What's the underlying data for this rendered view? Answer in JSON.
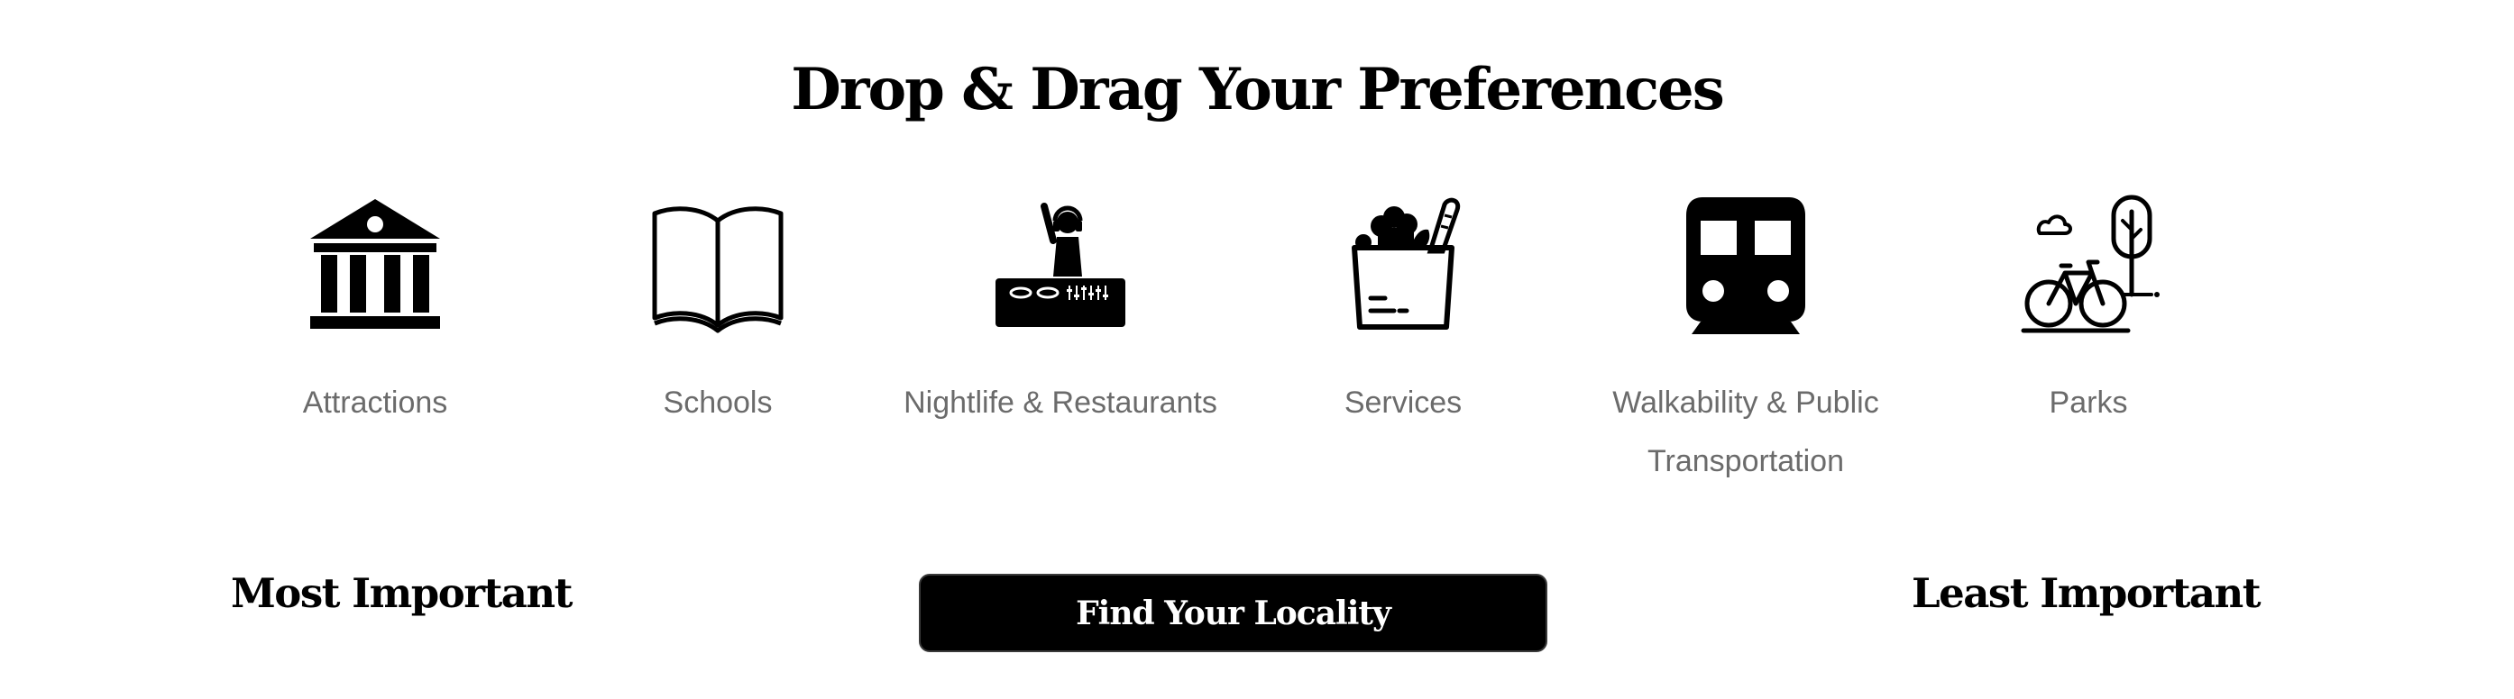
{
  "header": {
    "title": "Drop & Drag Your Preferences"
  },
  "preferences": [
    {
      "label": "Attractions",
      "icon": "museum-icon"
    },
    {
      "label": "Schools",
      "icon": "open-book-icon"
    },
    {
      "label": "Nightlife & Restaurants",
      "icon": "dj-booth-icon"
    },
    {
      "label": "Services",
      "icon": "grocery-bag-icon"
    },
    {
      "label": "Walkability & Public Transportation",
      "icon": "train-icon"
    },
    {
      "label": "Parks",
      "icon": "bicycle-tree-icon"
    }
  ],
  "ranking": {
    "most_label": "Most Important",
    "least_label": "Least Important"
  },
  "cta": {
    "label": "Find Your Locality"
  },
  "colors": {
    "text_primary": "#000000",
    "text_secondary": "#6b6b6b",
    "button_bg": "#000000",
    "button_text": "#ffffff"
  }
}
